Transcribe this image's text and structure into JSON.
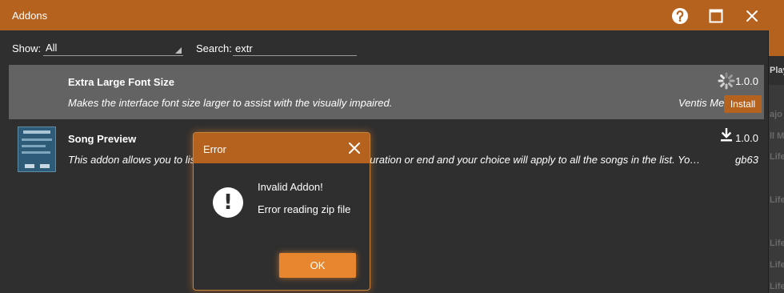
{
  "background_app": {
    "snippets": [
      "Play",
      "ajo",
      "ll M",
      "Life",
      "Life",
      "Life",
      "Life",
      "Life"
    ]
  },
  "window": {
    "title": "Addons",
    "buttons": {
      "help": "help-icon",
      "maximize": "maximize-icon",
      "close": "close-icon"
    }
  },
  "filters": {
    "show_label": "Show:",
    "show_value": "All",
    "search_label": "Search:",
    "search_value": "extr"
  },
  "addons": [
    {
      "name": "Extra Large Font Size",
      "description": "Makes the interface font size larger to assist with the visually impaired.",
      "version": "1.0.0",
      "author": "Ventis Me",
      "action_label": "Install",
      "status_icon": "loading-spinner-icon"
    },
    {
      "name": "Song Preview",
      "description": "This addon allows you to list all the songs and set preview start, duration or end and your choice will apply to all the songs in the list. Yo…",
      "version": "1.0.0",
      "author": "gb63",
      "status_icon": "download-icon"
    }
  ],
  "dialog": {
    "title": "Error",
    "message_title": "Invalid Addon!",
    "message_detail": "Error reading zip file",
    "ok_label": "OK"
  },
  "colors": {
    "accent": "#b5621f",
    "ok_button": "#e8862f",
    "window_bg": "#2f2f2f",
    "selected_row": "#636363"
  }
}
